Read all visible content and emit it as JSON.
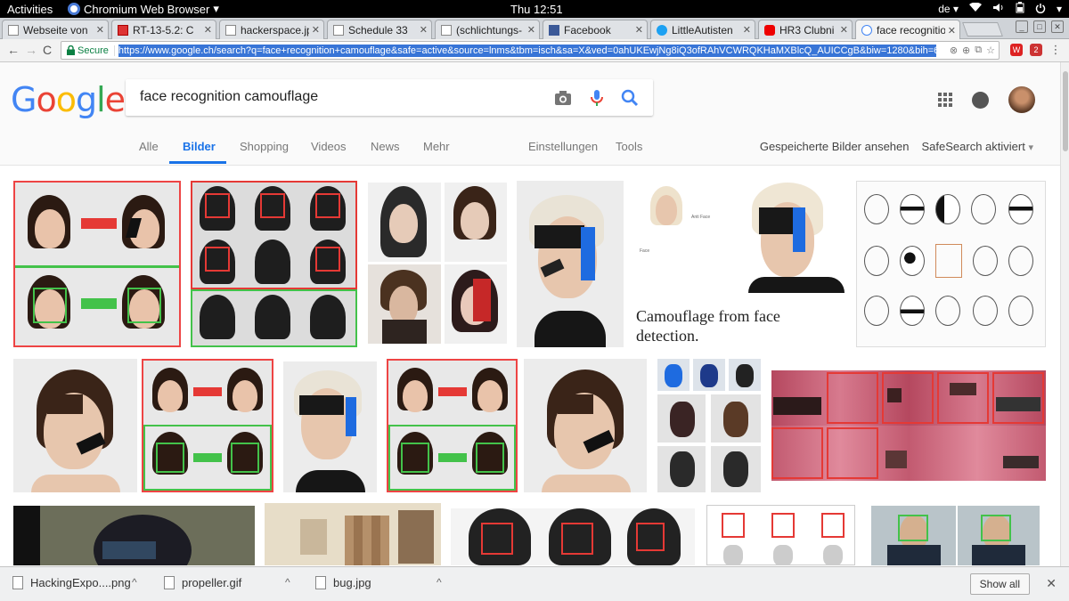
{
  "topbar": {
    "activities": "Activities",
    "app_name": "Chromium Web Browser",
    "app_arrow": "▾",
    "clock": "Thu 12:51",
    "keyboard": "de",
    "keyboard_arrow": "▾"
  },
  "tabs": [
    {
      "label": "Webseite von",
      "icon": "page"
    },
    {
      "label": "RT-13-5.2: C",
      "icon": "red"
    },
    {
      "label": "hackerspace.jp",
      "icon": "page"
    },
    {
      "label": "Schedule 33",
      "icon": "page"
    },
    {
      "label": "(schlichtungs-",
      "icon": "page"
    },
    {
      "label": "Facebook",
      "icon": "fb"
    },
    {
      "label": "LittleAutisten",
      "icon": "tw"
    },
    {
      "label": "HR3 Clubni",
      "icon": "yt"
    },
    {
      "label": "face recognitio",
      "icon": "g"
    }
  ],
  "toolbar": {
    "back": "←",
    "forward": "→",
    "reload": "C",
    "secure_label": "Secure",
    "url": "https://www.google.ch/search?q=face+recognition+camouflage&safe=active&source=lnms&tbm=isch&sa=X&ved=0ahUKEwjNg8iQ3ofRAhVCWRQKHaMXBlcQ_AUICCgB&biw=1280&bih=603",
    "ext_badge": "2"
  },
  "google": {
    "logo": "Google",
    "query": "face recognition camouflage",
    "tabs": [
      "Alle",
      "Bilder",
      "Shopping",
      "Videos",
      "News",
      "Mehr"
    ],
    "settings": "Einstellungen",
    "tools": "Tools",
    "saved_images": "Gespeicherte Bilder ansehen",
    "safesearch": "SafeSearch aktiviert",
    "safesearch_arrow": "▾"
  },
  "results": {
    "featured_caption_line1": "Camouflage from face",
    "featured_caption_line2": "detection.",
    "anti_face_label": "Anti Face",
    "face_label": "Face"
  },
  "downloads": {
    "items": [
      {
        "name": "HackingExpo....png"
      },
      {
        "name": "propeller.gif"
      },
      {
        "name": "bug.jpg"
      }
    ],
    "show_all": "Show all",
    "close": "✕",
    "chevron": "^"
  },
  "colors": {
    "google_blue": "#4285f4",
    "google_red": "#ea4335",
    "google_yellow": "#fbbc05",
    "google_green": "#34a853",
    "active_tab_blue": "#1a73e8",
    "url_highlight": "#3875d7"
  }
}
